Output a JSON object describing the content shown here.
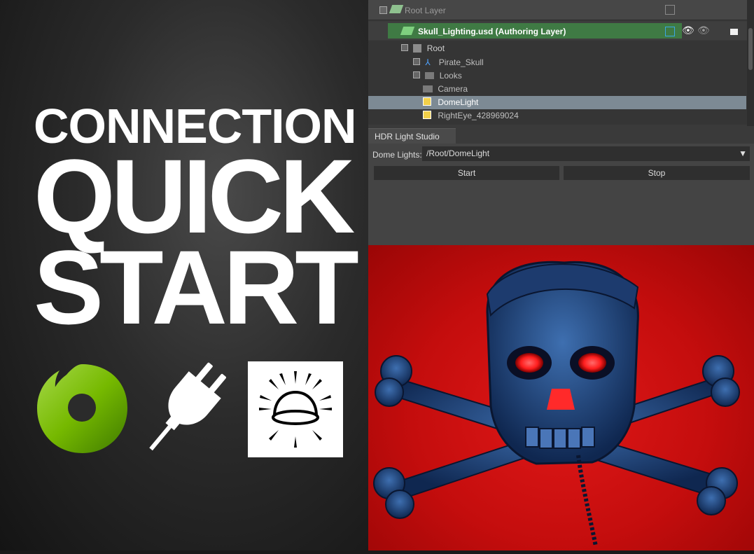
{
  "promo": {
    "line1": "CONNECTION",
    "line2": "QUICK",
    "line3": "START"
  },
  "icons": [
    "omniverse-logo-icon",
    "plug-icon",
    "hdr-light-studio-dome-icon"
  ],
  "layers": {
    "root_layer": "Root Layer",
    "authoring_layer": "Skull_Lighting.usd (Authoring Layer)"
  },
  "stage_tree": {
    "root": "Root",
    "items": [
      "Pirate_Skull",
      "Looks",
      "Camera",
      "DomeLight",
      "RightEye_428969024"
    ],
    "selected": "DomeLight"
  },
  "hdr_panel": {
    "tab": "HDR Light Studio",
    "dome_label": "Dome Lights:",
    "dome_value": "/Root/DomeLight",
    "start": "Start",
    "stop": "Stop"
  },
  "colors": {
    "authoring_green": "#3f7a44",
    "selection": "#7d8a94",
    "render_bg": "#d01010",
    "omni_green": "#76b900"
  }
}
